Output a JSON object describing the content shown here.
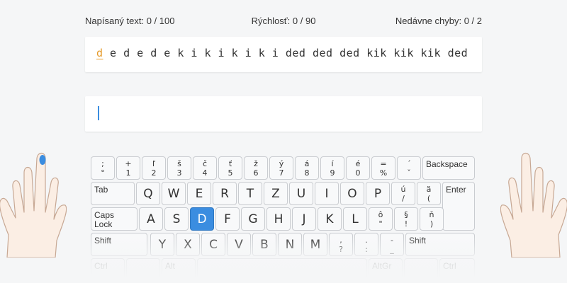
{
  "stats": {
    "typed": "Napísaný text: 0 / 100",
    "speed": "Rýchlosť: 0 / 90",
    "errors": "Nedávne chyby: 0 / 2"
  },
  "lesson": {
    "current_char": "d",
    "remaining_text": " e d e d e k i k i k i k i ded ded ded kik kik kik ded"
  },
  "input": {
    "value": ""
  },
  "keyboard": {
    "row1": [
      {
        "top": ";",
        "bottom": "°"
      },
      {
        "top": "+",
        "bottom": "1"
      },
      {
        "top": "ľ",
        "bottom": "2"
      },
      {
        "top": "š",
        "bottom": "3"
      },
      {
        "top": "č",
        "bottom": "4"
      },
      {
        "top": "ť",
        "bottom": "5"
      },
      {
        "top": "ž",
        "bottom": "6"
      },
      {
        "top": "ý",
        "bottom": "7"
      },
      {
        "top": "á",
        "bottom": "8"
      },
      {
        "top": "í",
        "bottom": "9"
      },
      {
        "top": "é",
        "bottom": "0"
      },
      {
        "top": "=",
        "bottom": "%"
      },
      {
        "top": "´",
        "bottom": "ˇ"
      }
    ],
    "backspace": "Backspace",
    "tab": "Tab",
    "row2": [
      "Q",
      "W",
      "E",
      "R",
      "T",
      "Z",
      "U",
      "I",
      "O",
      "P"
    ],
    "row2_extra": [
      {
        "top": "ú",
        "bottom": "/"
      },
      {
        "top": "ä",
        "bottom": "("
      }
    ],
    "enter": "Enter",
    "caps_line1": "Caps",
    "caps_line2": "Lock",
    "row3": [
      "A",
      "S",
      "D",
      "F",
      "G",
      "H",
      "J",
      "K",
      "L"
    ],
    "row3_extra": [
      {
        "top": "ô",
        "bottom": "\""
      },
      {
        "top": "§",
        "bottom": "!"
      },
      {
        "top": "ň",
        "bottom": ")"
      }
    ],
    "shift": "Shift",
    "row4": [
      "Y",
      "X",
      "C",
      "V",
      "B",
      "N",
      "M"
    ],
    "row4_extra": [
      {
        "top": ",",
        "bottom": "?"
      },
      {
        "top": ".",
        "bottom": ":"
      },
      {
        "top": "-",
        "bottom": "_"
      }
    ],
    "ctrl": "Ctrl",
    "alt": "Alt",
    "altgr": "AltGr",
    "active_key": "D"
  },
  "colors": {
    "accent": "#3b8de0",
    "current_char": "#e59a2a"
  }
}
